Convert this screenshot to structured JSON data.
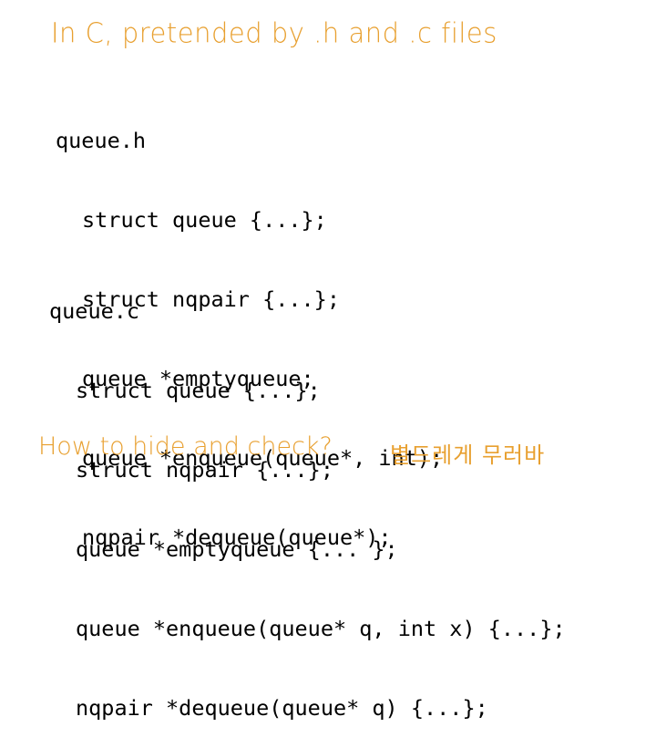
{
  "title": "In C, pretended by .h and .c files",
  "header_file": {
    "name": "queue.h",
    "lines": [
      "struct queue {...};",
      "struct nqpair {...};",
      "queue *emptyqueue;",
      "queue *enqueue(queue*, int);",
      "nqpair *dequeue(queue*);"
    ]
  },
  "source_file": {
    "name": "queue.c",
    "lines": [
      "struct queue {...};",
      "struct nqpair {...};",
      "queue *emptyqueue {... };",
      "queue *enqueue(queue* q, int x) {...};",
      "nqpair *dequeue(queue* q) {...};"
    ]
  },
  "question": "How to hide and check?",
  "korean_note": "별드레게 무러바",
  "colors": {
    "accent": "#e8a030",
    "code": "#000000",
    "background": "#ffffff"
  }
}
